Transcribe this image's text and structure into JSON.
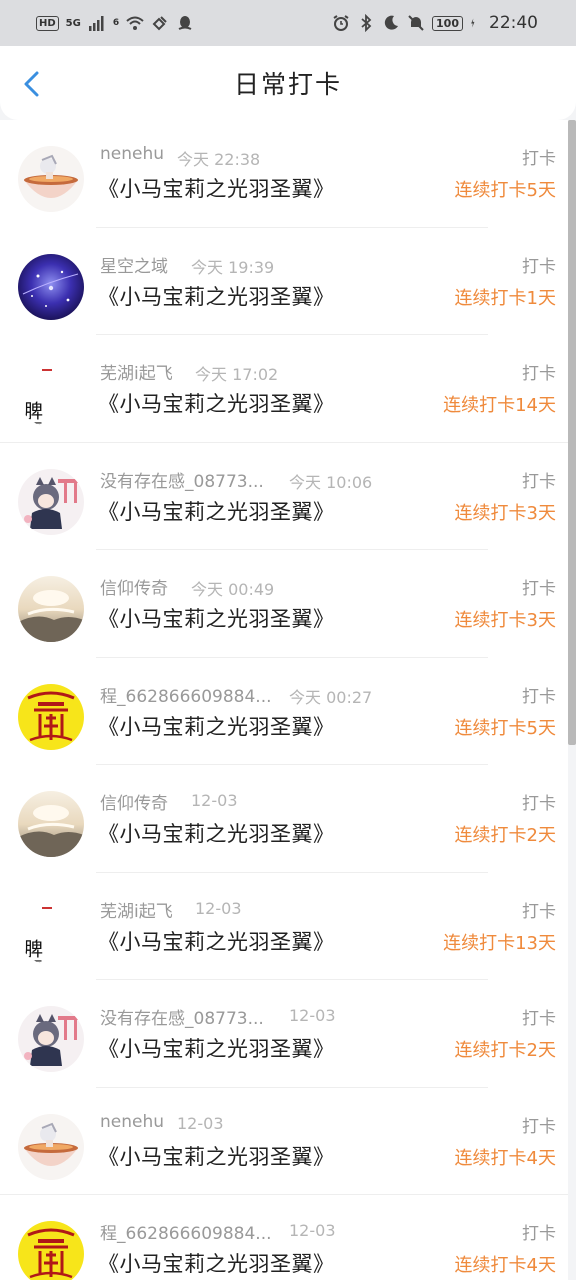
{
  "status_bar": {
    "hd": "HD",
    "net": "5G",
    "wifi_num": "6",
    "battery": "100",
    "time": "22:40"
  },
  "header": {
    "title": "日常打卡"
  },
  "list": [
    {
      "name": "nenehu",
      "time": "今天 22:38",
      "book": "《小马宝莉之光羽圣翼》",
      "action": "打卡",
      "streak": "连续打卡5天",
      "avatar": "noodle-girl-avatar"
    },
    {
      "name": "星空之域",
      "time": "今天 19:39",
      "book": "《小马宝莉之光羽圣翼》",
      "action": "打卡",
      "streak": "连续打卡1天",
      "avatar": "starry-sky-avatar"
    },
    {
      "name": "芜湖i起飞",
      "time": "今天 17:02",
      "book": "《小马宝莉之光羽圣翼》",
      "action": "打卡",
      "streak": "连续打卡14天",
      "avatar": "calligraphy-avatar",
      "calligraphy": "脾氣"
    },
    {
      "name": "没有存在感_08773...",
      "time": "今天 10:06",
      "book": "《小马宝莉之光羽圣翼》",
      "action": "打卡",
      "streak": "连续打卡3天",
      "avatar": "anime-fox-avatar"
    },
    {
      "name": "信仰传奇",
      "time": "今天 00:49",
      "book": "《小马宝莉之光羽圣翼》",
      "action": "打卡",
      "streak": "连续打卡3天",
      "avatar": "misty-landscape-avatar"
    },
    {
      "name": "程_662866609884...",
      "time": "今天 00:27",
      "book": "《小马宝莉之光羽圣翼》",
      "action": "打卡",
      "streak": "连续打卡5天",
      "avatar": "yellow-talisman-avatar"
    },
    {
      "name": "信仰传奇",
      "time": "12-03",
      "book": "《小马宝莉之光羽圣翼》",
      "action": "打卡",
      "streak": "连续打卡2天",
      "avatar": "misty-landscape-avatar"
    },
    {
      "name": "芜湖i起飞",
      "time": "12-03",
      "book": "《小马宝莉之光羽圣翼》",
      "action": "打卡",
      "streak": "连续打卡13天",
      "avatar": "calligraphy-avatar",
      "calligraphy": "脾氣"
    },
    {
      "name": "没有存在感_08773...",
      "time": "12-03",
      "book": "《小马宝莉之光羽圣翼》",
      "action": "打卡",
      "streak": "连续打卡2天",
      "avatar": "anime-fox-avatar"
    },
    {
      "name": "nenehu",
      "time": "12-03",
      "book": "《小马宝莉之光羽圣翼》",
      "action": "打卡",
      "streak": "连续打卡4天",
      "avatar": "noodle-girl-avatar"
    },
    {
      "name": "程_662866609884...",
      "time": "12-03",
      "book": "《小马宝莉之光羽圣翼》",
      "action": "打卡",
      "streak": "连续打卡4天",
      "avatar": "yellow-talisman-avatar"
    }
  ],
  "colors": {
    "accent": "#3a8fe0",
    "streak": "#ef8a3c",
    "muted": "#999999"
  }
}
